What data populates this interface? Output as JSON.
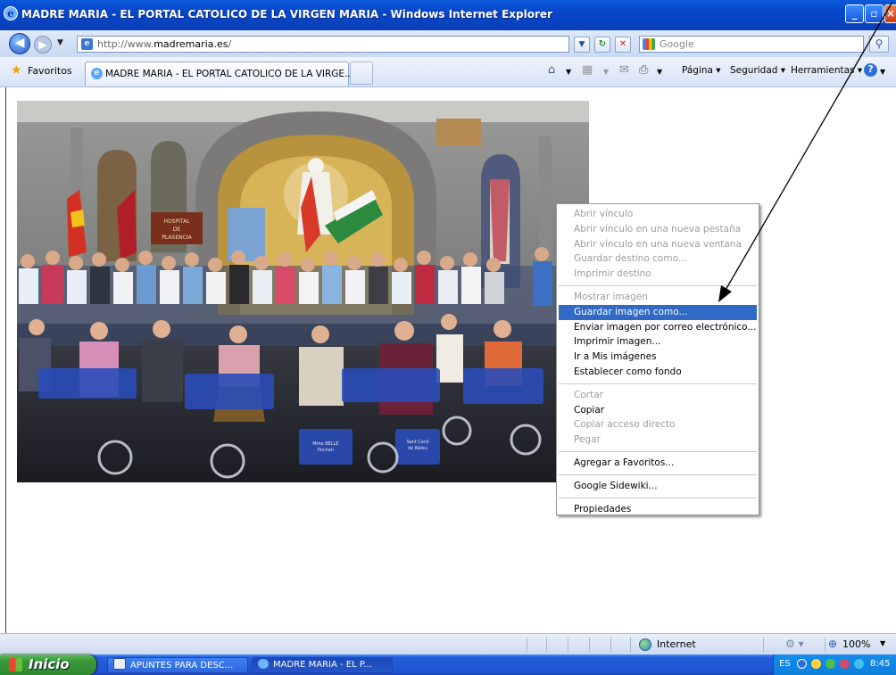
{
  "window": {
    "title": "MADRE MARIA - EL PORTAL CATOLICO DE LA VIRGEN MARIA - Windows Internet Explorer"
  },
  "address_bar": {
    "url_prefix": "http://www.",
    "url_domain": "madremaria.es",
    "url_suffix": "/",
    "search_placeholder": "Google"
  },
  "favorites_bar": {
    "favorites_label": "Favoritos",
    "tab_title": "MADRE MARIA - EL PORTAL CATOLICO DE LA VIRGE...",
    "commands": [
      "Página",
      "Seguridad",
      "Herramientas"
    ]
  },
  "photo": {
    "banner_text": [
      "HOSPITAL",
      "DE",
      "PLASENCIA"
    ],
    "seat_text_1": [
      "Mme BELLE",
      "Pochon",
      "..."
    ],
    "seat_text_2": [
      "Sant Cecil",
      "de Beleu"
    ]
  },
  "context_menu": {
    "groups": [
      [
        {
          "label": "Abrir vínculo",
          "enabled": false
        },
        {
          "label": "Abrir vínculo en una nueva pestaña",
          "enabled": false
        },
        {
          "label": "Abrir vínculo en una nueva ventana",
          "enabled": false
        },
        {
          "label": "Guardar destino como...",
          "enabled": false
        },
        {
          "label": "Imprimir destino",
          "enabled": false
        }
      ],
      [
        {
          "label": "Mostrar imagen",
          "enabled": false
        },
        {
          "label": "Guardar imagen como...",
          "enabled": true,
          "highlighted": true
        },
        {
          "label": "Enviar imagen por correo electrónico...",
          "enabled": true
        },
        {
          "label": "Imprimir imagen...",
          "enabled": true
        },
        {
          "label": "Ir a Mis imágenes",
          "enabled": true
        },
        {
          "label": "Establecer como fondo",
          "enabled": true
        }
      ],
      [
        {
          "label": "Cortar",
          "enabled": false
        },
        {
          "label": "Copiar",
          "enabled": true
        },
        {
          "label": "Copiar acceso directo",
          "enabled": false
        },
        {
          "label": "Pegar",
          "enabled": false
        }
      ],
      [
        {
          "label": "Agregar a Favoritos...",
          "enabled": true
        }
      ],
      [
        {
          "label": "Google Sidewiki...",
          "enabled": true
        }
      ],
      [
        {
          "label": "Propiedades",
          "enabled": true
        }
      ]
    ]
  },
  "status_bar": {
    "zone": "Internet",
    "zoom": "100%"
  },
  "taskbar": {
    "start_label": "Inicio",
    "tasks": [
      {
        "label": "APUNTES PARA DESC...",
        "icon": "word-doc-icon",
        "active": false
      },
      {
        "label": "MADRE MARIA - EL P...",
        "icon": "ie-icon",
        "active": true
      }
    ],
    "language": "ES",
    "clock": "8:45"
  },
  "colors": {
    "titlebar": "#0746c9",
    "menu_highlight": "#316ac5",
    "taskbar": "#245edb",
    "start_button": "#3a9a3a"
  }
}
